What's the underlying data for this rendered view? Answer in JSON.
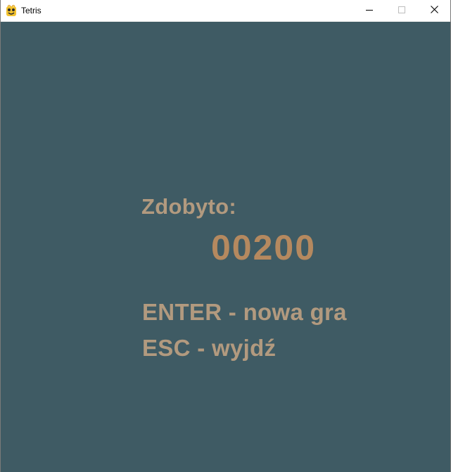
{
  "window": {
    "title": "Tetris",
    "icon": "pygame-snake-icon",
    "controls": {
      "minimize_icon": "minimize-icon",
      "maximize_icon": "maximize-icon",
      "close_icon": "close-icon"
    }
  },
  "game": {
    "background_color": "#3f5b64",
    "text_color": "#b29a7f",
    "score_color": "#b5895f",
    "score_label": "Zdobyto:",
    "score_value": "00200",
    "menu": {
      "enter_option": "ENTER - nowa gra",
      "esc_option": "ESC - wyjdź"
    }
  }
}
